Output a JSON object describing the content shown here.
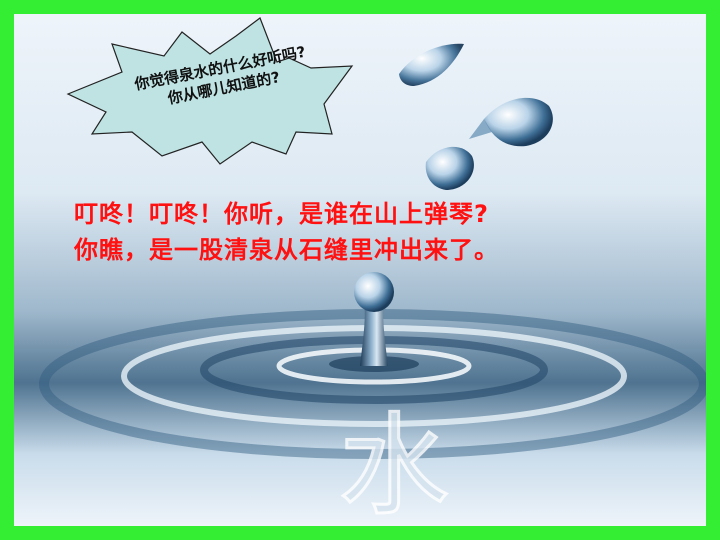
{
  "slide": {
    "callout": {
      "line1": "你觉得泉水的什么好听吗?",
      "line2": "你从哪儿知道的?"
    },
    "text": {
      "line1": "叮咚！叮咚！你听，是谁在山上弹琴?",
      "line2": "你瞧，是一股清泉从石缝里冲出来了。"
    },
    "watermark_char": "水"
  },
  "colors": {
    "border": "#33ee33",
    "callout_fill": "#bfe3e3",
    "main_text": "#ff1111"
  },
  "icons": [
    "explosion-callout-shape",
    "water-droplet-icon",
    "water-splash-icon"
  ]
}
